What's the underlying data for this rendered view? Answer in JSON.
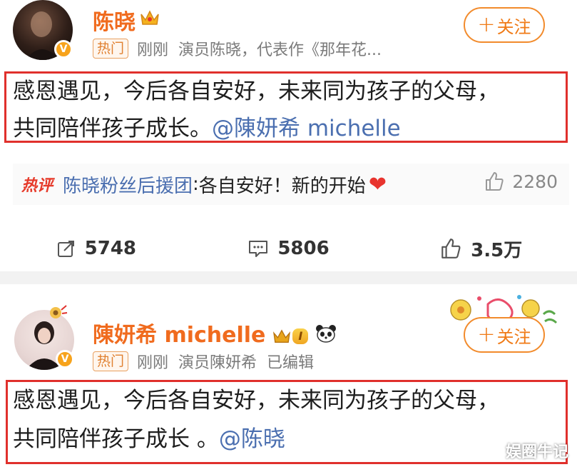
{
  "post1": {
    "author": "陈晓",
    "tag": "热门",
    "time": "刚刚",
    "bio": "演员陈晓，代表作《那年花...",
    "follow_label": "关注",
    "content_line1": "感恩遇见，今后各自安好，未来同为孩子的父母，",
    "content_line2": "共同陪伴孩子成长。",
    "mention": "@陳妍希 michelle",
    "hot_comment": {
      "label": "热评",
      "user": "陈晓粉丝后援团",
      "colon": ":",
      "text": " 各自安好！新的开始",
      "likes": "2280"
    },
    "actions": {
      "reposts": "5748",
      "comments": "5806",
      "likes": "3.5万"
    }
  },
  "post2": {
    "author": "陳妍希 michelle",
    "level": "I",
    "tag": "热门",
    "time": "刚刚",
    "bio": "演员陳妍希",
    "edited": "已编辑",
    "follow_label": "关注",
    "content_line1": "感恩遇见，今后各自安好，未来同为孩子的父母，",
    "content_line2": "共同陪伴孩子成长 。",
    "mention": "@陈晓"
  },
  "watermark": "娱圈牛记",
  "colors": {
    "accent_orange": "#f06b1e",
    "link_blue": "#4b6fb0",
    "highlight_red": "#e0302c"
  }
}
